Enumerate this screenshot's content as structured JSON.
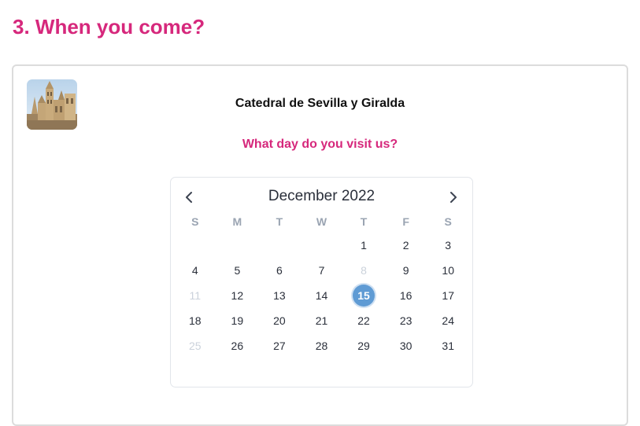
{
  "page": {
    "step_title": "3. When you come?"
  },
  "place": {
    "name": "Catedral de Sevilla y Giralda",
    "thumbnail_icon": "cathedral-photo"
  },
  "question": "What day do you visit us?",
  "calendar": {
    "month_label": "December 2022",
    "prev_icon": "chevron-left-icon",
    "next_icon": "chevron-right-icon",
    "accent_color": "#5f9bd4",
    "weekdays": [
      "S",
      "M",
      "T",
      "W",
      "T",
      "F",
      "S"
    ],
    "weeks": [
      [
        {
          "label": "",
          "state": "empty"
        },
        {
          "label": "",
          "state": "empty"
        },
        {
          "label": "",
          "state": "empty"
        },
        {
          "label": "",
          "state": "empty"
        },
        {
          "label": "1",
          "state": "enabled"
        },
        {
          "label": "2",
          "state": "enabled"
        },
        {
          "label": "3",
          "state": "enabled"
        }
      ],
      [
        {
          "label": "4",
          "state": "enabled"
        },
        {
          "label": "5",
          "state": "enabled"
        },
        {
          "label": "6",
          "state": "enabled"
        },
        {
          "label": "7",
          "state": "enabled"
        },
        {
          "label": "8",
          "state": "disabled"
        },
        {
          "label": "9",
          "state": "enabled"
        },
        {
          "label": "10",
          "state": "enabled"
        }
      ],
      [
        {
          "label": "11",
          "state": "disabled"
        },
        {
          "label": "12",
          "state": "enabled"
        },
        {
          "label": "13",
          "state": "enabled"
        },
        {
          "label": "14",
          "state": "enabled"
        },
        {
          "label": "15",
          "state": "selected"
        },
        {
          "label": "16",
          "state": "enabled"
        },
        {
          "label": "17",
          "state": "enabled"
        }
      ],
      [
        {
          "label": "18",
          "state": "enabled"
        },
        {
          "label": "19",
          "state": "enabled"
        },
        {
          "label": "20",
          "state": "enabled"
        },
        {
          "label": "21",
          "state": "enabled"
        },
        {
          "label": "22",
          "state": "enabled"
        },
        {
          "label": "23",
          "state": "enabled"
        },
        {
          "label": "24",
          "state": "enabled"
        }
      ],
      [
        {
          "label": "25",
          "state": "disabled"
        },
        {
          "label": "26",
          "state": "enabled"
        },
        {
          "label": "27",
          "state": "enabled"
        },
        {
          "label": "28",
          "state": "enabled"
        },
        {
          "label": "29",
          "state": "enabled"
        },
        {
          "label": "30",
          "state": "enabled"
        },
        {
          "label": "31",
          "state": "enabled"
        }
      ]
    ]
  }
}
